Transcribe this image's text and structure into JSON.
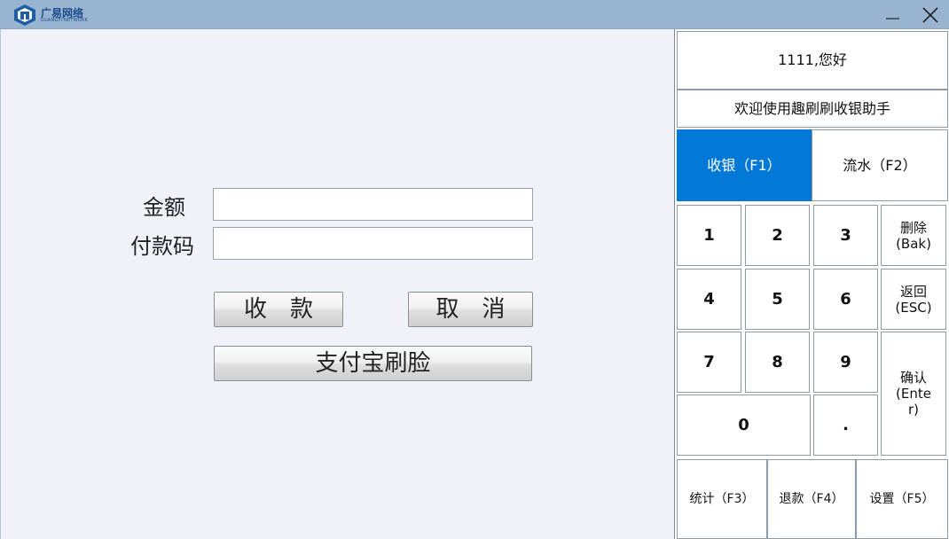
{
  "titlebar": {
    "logo_text": "广易网络",
    "logo_sub": "GUANGYI NETWORK",
    "minimize_glyph": "—",
    "close_glyph": "✕"
  },
  "form": {
    "amount_label": "金额",
    "code_label": "付款码",
    "amount_value": "",
    "code_value": "",
    "collect_button": "收　款",
    "cancel_button": "取　消",
    "face_pay_button": "支付宝刷脸"
  },
  "panel": {
    "greeting": "1111,您好",
    "welcome": "欢迎使用趣刷刷收银助手",
    "tabs": [
      {
        "label": "收银（F1）",
        "active": true
      },
      {
        "label": "流水（F2）",
        "active": false
      }
    ],
    "keypad": {
      "k1": "1",
      "k2": "2",
      "k3": "3",
      "k4": "4",
      "k5": "5",
      "k6": "6",
      "k7": "7",
      "k8": "8",
      "k9": "9",
      "k0": "0",
      "dot": ".",
      "delete_line1": "删除",
      "delete_line2": "(Bak)",
      "back_line1": "返回",
      "back_line2": "(ESC)",
      "confirm_line1": "确认",
      "confirm_line2": "(Ente",
      "confirm_line3": "r)"
    },
    "functions": [
      {
        "label": "统计（F3）"
      },
      {
        "label": "退款（F4）"
      },
      {
        "label": "设置（F5）"
      }
    ]
  },
  "colors": {
    "titlebar": "#99b4d1",
    "active_tab": "#0078d7",
    "logo": "#1a4c8c"
  }
}
